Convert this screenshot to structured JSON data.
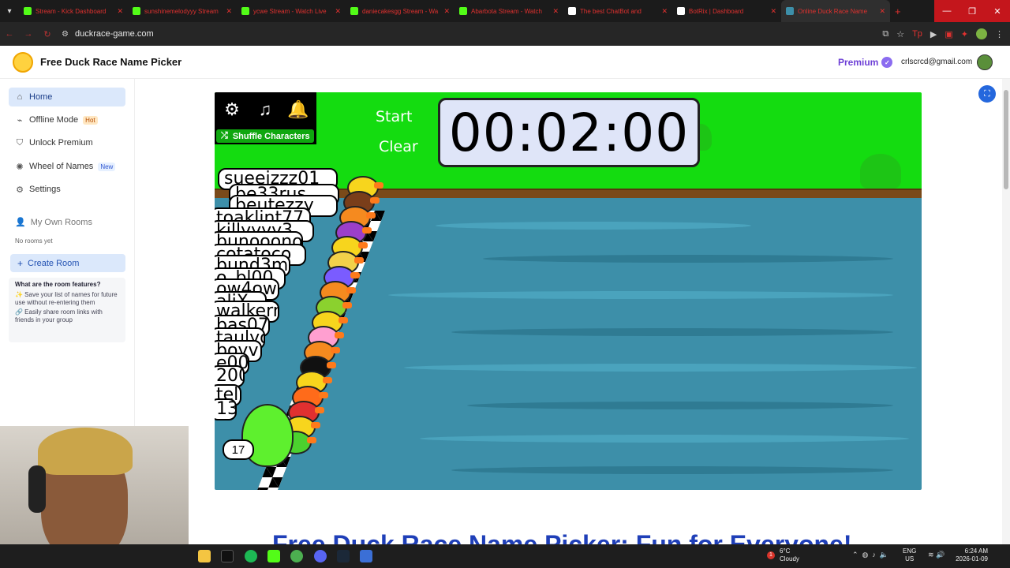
{
  "browser": {
    "tabs": [
      {
        "title": "Stream - Kick Dashboard",
        "fav": "#53fc18"
      },
      {
        "title": "sunshinemelodyyy Stream",
        "fav": "#53fc18"
      },
      {
        "title": "ycwe Stream - Watch Live",
        "fav": "#53fc18"
      },
      {
        "title": "daniecakesgg Stream - Wa",
        "fav": "#53fc18"
      },
      {
        "title": "Abarbota Stream - Watch",
        "fav": "#53fc18"
      },
      {
        "title": "The best ChatBot and",
        "fav": "#ffffff"
      },
      {
        "title": "BotRix | Dashboard",
        "fav": "#ffffff"
      },
      {
        "title": "Online Duck Race Name",
        "fav": "#3d8fa9"
      }
    ],
    "url": "duckrace-game.com"
  },
  "header": {
    "title": "Free Duck Race Name Picker",
    "premium_label": "Premium",
    "email": "crlscrcd@gmail.com"
  },
  "sidebar": {
    "items": [
      {
        "label": "Home",
        "icon": "home-icon"
      },
      {
        "label": "Offline Mode",
        "tag": "Hot",
        "icon": "offline-icon"
      },
      {
        "label": "Unlock Premium",
        "icon": "shield-icon"
      },
      {
        "label": "Wheel of Names",
        "tag": "New",
        "icon": "wheel-icon"
      },
      {
        "label": "Settings",
        "icon": "gear-icon"
      }
    ],
    "rooms_title": "My Own Rooms",
    "no_rooms": "No rooms yet",
    "create_room": "Create Room",
    "features_title": "What are the room features?",
    "feature_1": "✨ Save your list of names for future use without re-entering them",
    "feature_2": "🔗 Easily share room links with friends in your group"
  },
  "game": {
    "shuffle_label": "Shuffle Characters",
    "start_label": "Start",
    "clear_label": "Clear",
    "timer": "00:02:00",
    "names": [
      "sueeizzz01",
      "be33rus",
      "beutezzy",
      "toaklint77",
      "killyyyy3",
      "bunooono",
      "cotatoco",
      "bund3m",
      "o_bl00",
      "ow4owo",
      "aliX",
      "walkerr",
      "bas07",
      "taulyo",
      "boyv",
      "e003",
      "200",
      "tell",
      "13"
    ],
    "number_badge": "17"
  },
  "below_heading": "Free Duck Race Name Picker: Fun for Everyone!",
  "taskbar": {
    "temp": "6°C",
    "weather": "Cloudy",
    "weather_badge": "1",
    "lang_1": "ENG",
    "lang_2": "US",
    "time": "6:24 AM",
    "date": "2026-01-09"
  }
}
